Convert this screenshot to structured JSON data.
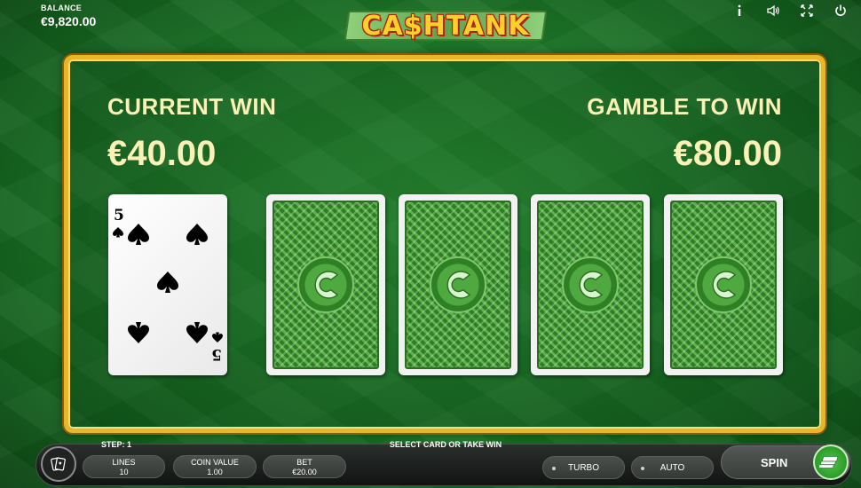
{
  "balance": {
    "label": "BALANCE",
    "value": "€9,820.00"
  },
  "logo": {
    "text": "CA$HTANK"
  },
  "top_icons": [
    "info-icon",
    "sound-icon",
    "fullscreen-icon",
    "power-icon"
  ],
  "gamble": {
    "current_win_label": "CURRENT WIN",
    "current_win_value": "€40.00",
    "gamble_label": "GAMBLE TO WIN",
    "gamble_value": "€80.00",
    "revealed_card": {
      "rank": "5",
      "suit": "spades"
    },
    "hidden_cards_count": 4
  },
  "bottom": {
    "step_label": "STEP: 1",
    "status_message": "SELECT CARD OR TAKE WIN",
    "lines_label": "LINES",
    "lines_value": "10",
    "coin_label": "COIN VALUE",
    "coin_value": "1.00",
    "bet_label": "BET",
    "bet_value": "€20.00",
    "turbo_label": "TURBO",
    "auto_label": "AUTO",
    "spin_label": "SPIN"
  },
  "colors": {
    "panel_border": "#e8b628",
    "win_text": "#fbf0b6",
    "logo_text": "#ffcf2a",
    "card_back": "#3c8d2f"
  }
}
